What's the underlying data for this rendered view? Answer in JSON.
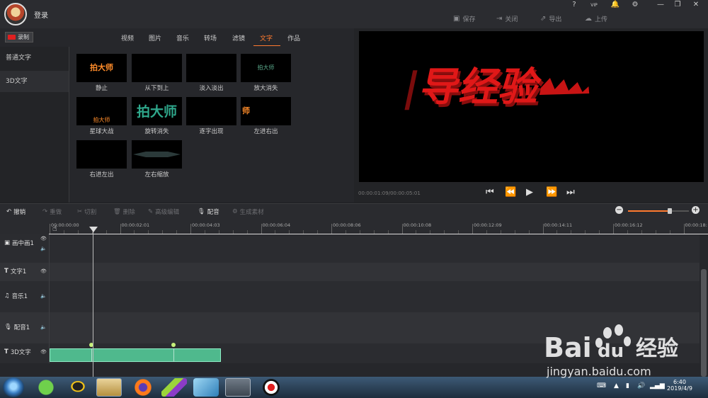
{
  "header": {
    "login": "登录",
    "window_controls": [
      "?",
      "VIP",
      "🔔",
      "⚙",
      "—",
      "❐",
      "✕"
    ],
    "actions": [
      {
        "label": "保存",
        "icon": "save-icon"
      },
      {
        "label": "关闭",
        "icon": "close-project-icon"
      },
      {
        "label": "导出",
        "icon": "export-icon"
      },
      {
        "label": "上传",
        "icon": "upload-icon"
      }
    ]
  },
  "record_label": "录制",
  "tabs": [
    {
      "label": "视频",
      "active": false
    },
    {
      "label": "图片",
      "active": false
    },
    {
      "label": "音乐",
      "active": false
    },
    {
      "label": "转场",
      "active": false
    },
    {
      "label": "滤镜",
      "active": false
    },
    {
      "label": "文字",
      "active": true
    },
    {
      "label": "作品",
      "active": false
    }
  ],
  "categories": [
    {
      "label": "普通文字",
      "selected": false
    },
    {
      "label": "3D文字",
      "selected": true
    }
  ],
  "effects": [
    {
      "label": "静止",
      "preview": "拍大师"
    },
    {
      "label": "从下到上",
      "preview": ""
    },
    {
      "label": "淡入淡出",
      "preview": ""
    },
    {
      "label": "放大消失",
      "preview": "拍大师"
    },
    {
      "label": "星球大战",
      "preview": "拍大师"
    },
    {
      "label": "旋转消失",
      "preview": "拍大师"
    },
    {
      "label": "逐字出现",
      "preview": ""
    },
    {
      "label": "左进右出",
      "preview": "师"
    },
    {
      "label": "右进左出",
      "preview": ""
    },
    {
      "label": "左右缩放",
      "preview": ""
    }
  ],
  "preview": {
    "text": "导经验",
    "timecode": "00:00:01:09/00:00:05:01"
  },
  "toolbar": {
    "tools": [
      {
        "label": "撤销",
        "icon": "undo-icon",
        "enabled": true
      },
      {
        "label": "重做",
        "icon": "redo-icon",
        "enabled": false
      },
      {
        "label": "切割",
        "icon": "scissors-icon",
        "enabled": false
      },
      {
        "label": "删除",
        "icon": "trash-icon",
        "enabled": false
      },
      {
        "label": "高级编辑",
        "icon": "pencil-icon",
        "enabled": false
      },
      {
        "label": "配音",
        "icon": "microphone-icon",
        "enabled": true
      },
      {
        "label": "生成素材",
        "icon": "gear-icon",
        "enabled": false
      }
    ],
    "zoom_level": 0.68
  },
  "ruler_ticks": [
    "00:00:00:00",
    "00:00:02:01",
    "00:00:04:03",
    "00:00:06:04",
    "00:00:08:06",
    "00:00:10:08",
    "00:00:12:09",
    "00:00:14:11",
    "00:00:16:12",
    "00:00:18:"
  ],
  "tracks": [
    {
      "label": "画中画1",
      "icon": "pip-icon"
    },
    {
      "label": "文字1",
      "icon": "text-icon"
    },
    {
      "label": "音乐1",
      "icon": "music-icon"
    },
    {
      "label": "配音1",
      "icon": "microphone-icon"
    },
    {
      "label": "3D文字",
      "icon": "text-icon"
    }
  ],
  "taskbar": {
    "time": "6:40",
    "date": "2019/4/9"
  },
  "watermark": {
    "brand": "Bai",
    "brand2": "du",
    "suffix": "经验",
    "url": "jingyan.baidu.com"
  },
  "colors": {
    "accent": "#ff7a2f",
    "clip": "#4fb98d",
    "preview_text": "#e01818"
  }
}
